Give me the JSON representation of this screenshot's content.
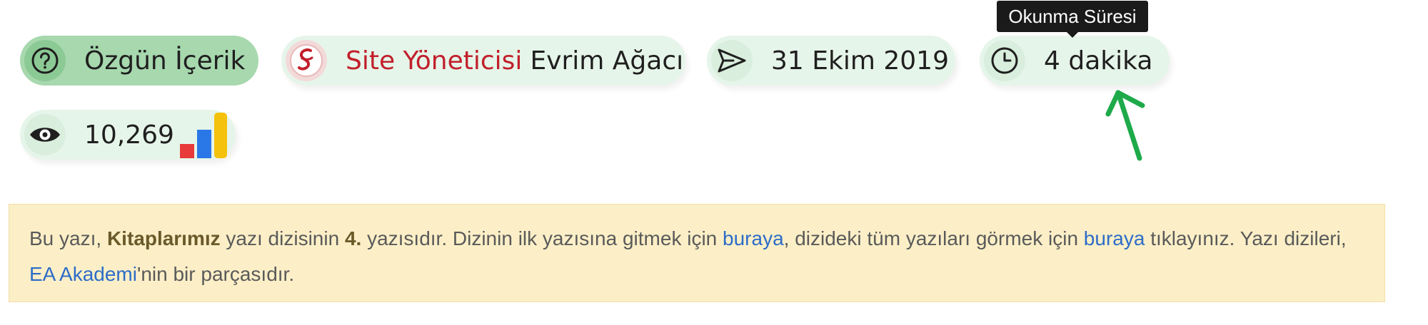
{
  "meta": {
    "original_content": "Özgün İçerik",
    "author_role": "Site Yöneticisi",
    "author_name": "Evrim Ağacı",
    "date": "31 Ekim 2019",
    "reading_time": "4 dakika",
    "view_count": "10,269"
  },
  "tooltip": "Okunma Süresi",
  "notice": {
    "p1": "Bu yazı, ",
    "series_name": "Kitaplarımız",
    "p2": " yazı dizisinin ",
    "order": "4.",
    "p3": " yazısıdır. Dizinin ilk yazısına gitmek için ",
    "link1": "buraya",
    "p4": ", dizideki tüm yazıları görmek için ",
    "link2": "buraya",
    "p5": " tıklayınız. Yazı dizileri, ",
    "link3": "EA Akademi",
    "p6": "'nin bir parçasıdır."
  },
  "colors": {
    "pill_bg": "#e6f5e9",
    "pill_active_bg": "#a7d8ae",
    "notice_bg": "#fcefc7",
    "link": "#2d6cc8",
    "author_role": "#c11f2b",
    "annotation_arrow": "#1eaa4a"
  },
  "icons": [
    "question-circle-icon",
    "site-logo-icon",
    "send-icon",
    "clock-icon",
    "eye-icon",
    "bar-chart-icon",
    "annotation-arrow"
  ]
}
